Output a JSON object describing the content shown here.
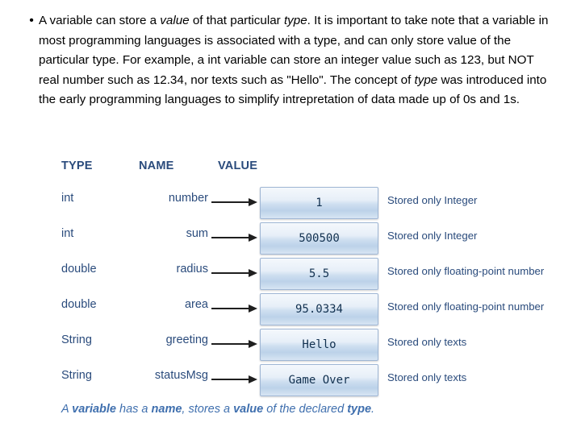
{
  "bullet": {
    "marker": "•",
    "segments": [
      {
        "text": "A variable can store a ",
        "style": "normal"
      },
      {
        "text": "value",
        "style": "italic"
      },
      {
        "text": " of that particular ",
        "style": "normal"
      },
      {
        "text": "type",
        "style": "italic"
      },
      {
        "text": ". It is important to take note that a variable in most programming languages is associated with a type, and can only store value of the particular type. For example, a int variable can store an integer value such as 123, but NOT real number such as 12.34, nor texts such as \"Hello\". The concept of ",
        "style": "normal"
      },
      {
        "text": "type",
        "style": "italic"
      },
      {
        "text": " was introduced into the early programming languages to simplify intrepretation of data made up of 0s and 1s.",
        "style": "normal"
      }
    ]
  },
  "diagram": {
    "headers": {
      "type": "TYPE",
      "name": "NAME",
      "value": "VALUE"
    },
    "rows": [
      {
        "type": "int",
        "name": "number",
        "value": "1",
        "note": "Stored only Integer"
      },
      {
        "type": "int",
        "name": "sum",
        "value": "500500",
        "note": "Stored only Integer"
      },
      {
        "type": "double",
        "name": "radius",
        "value": "5.5",
        "note": "Stored only floating-point number"
      },
      {
        "type": "double",
        "name": "area",
        "value": "95.0334",
        "note": "Stored only floating-point number"
      },
      {
        "type": "String",
        "name": "greeting",
        "value": "Hello",
        "note": "Stored only texts"
      },
      {
        "type": "String",
        "name": "statusMsg",
        "value": "Game Over",
        "note": "Stored only texts"
      }
    ],
    "footer": {
      "part1": "A ",
      "em1": "variable",
      "part2": " has a ",
      "em2": "name",
      "part3": ", stores a ",
      "em3": "value",
      "part4": " of the declared ",
      "em4": "type",
      "part5": "."
    }
  },
  "colors": {
    "accent": "#2a4b7c",
    "footer": "#3f6fae",
    "box_border": "#9fb6d4"
  }
}
